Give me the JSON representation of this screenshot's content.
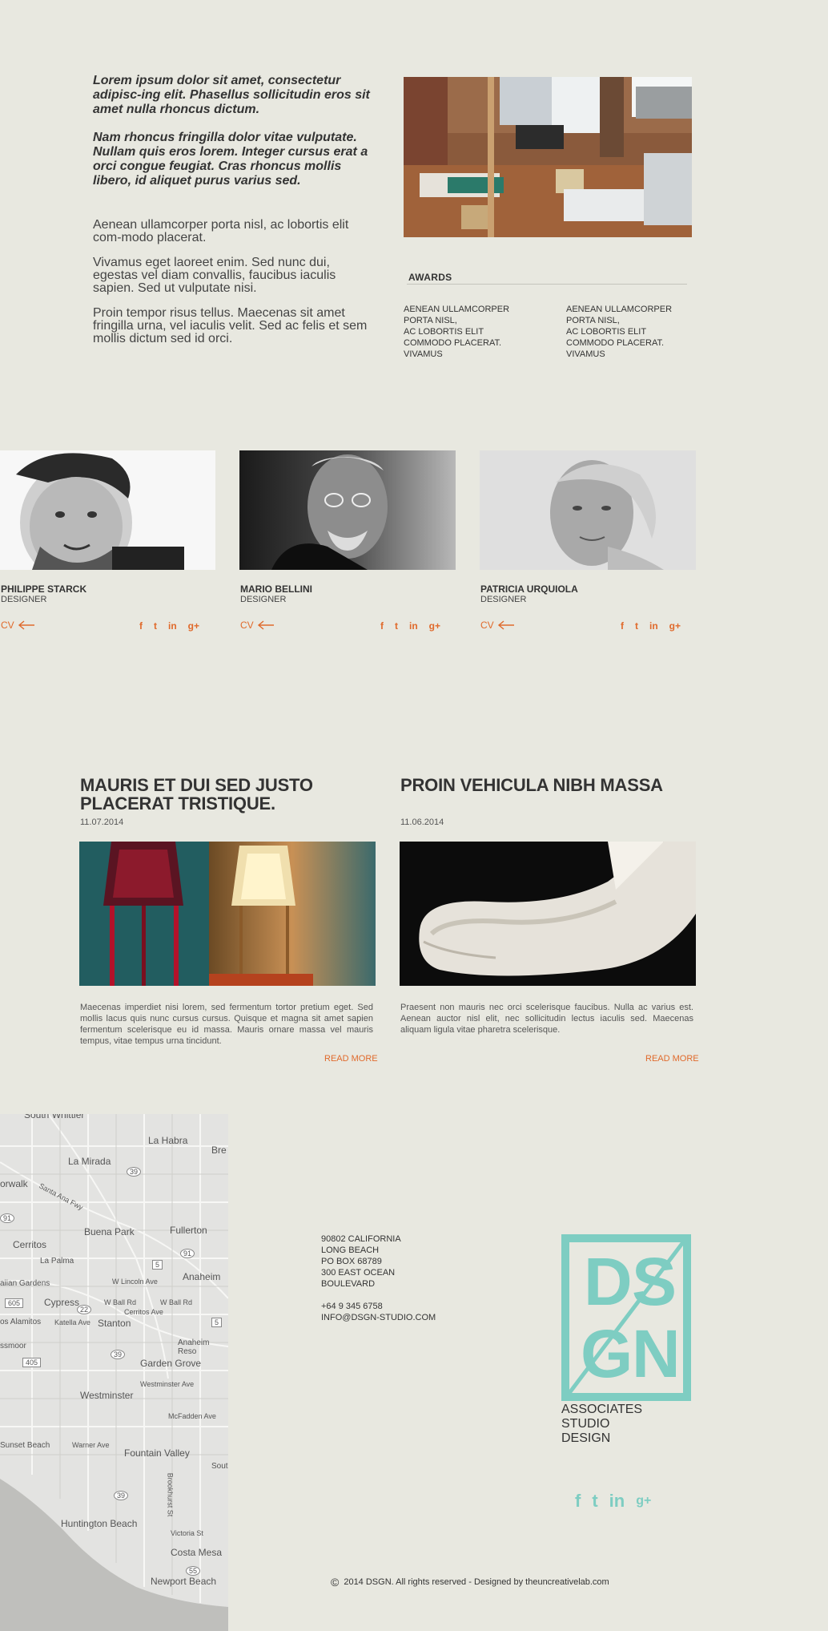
{
  "intro": {
    "italic_paragraphs": [
      "Lorem ipsum dolor sit amet, consectetur adipisc-ing elit. Phasellus sollicitudin eros sit amet nulla rhoncus dictum.",
      "Nam rhoncus fringilla dolor vitae vulputate. Nullam quis eros lorem. Integer cursus erat a orci congue feugiat. Cras rhoncus mollis libero, id aliquet purus varius sed."
    ],
    "regular_paragraphs": [
      "Aenean ullamcorper porta nisl, ac lobortis elit com-modo placerat.",
      "Vivamus eget laoreet enim. Sed nunc dui, egestas vel diam convallis, faucibus iaculis sapien. Sed ut vulputate nisi.",
      "Proin tempor risus tellus. Maecenas sit amet fringilla urna, vel iaculis velit. Sed ac felis et sem mollis dictum sed id orci."
    ]
  },
  "awards": {
    "title": "AWARDS",
    "columns": [
      [
        "AENEAN ULLAMCORPER PORTA NISL,",
        "AC LOBORTIS ELIT",
        "COMMODO PLACERAT.",
        "VIVAMUS"
      ],
      [
        "AENEAN ULLAMCORPER PORTA NISL,",
        "AC LOBORTIS ELIT",
        "COMMODO PLACERAT.",
        "VIVAMUS"
      ]
    ]
  },
  "team": {
    "cv_label": "CV",
    "members": [
      {
        "name": "PHILIPPE STARCK",
        "role": "DESIGNER"
      },
      {
        "name": "MARIO BELLINI",
        "role": "DESIGNER"
      },
      {
        "name": "PATRICIA URQUIOLA",
        "role": "DESIGNER"
      }
    ],
    "social_glyphs": [
      "f",
      "t",
      "in",
      "g+"
    ]
  },
  "posts": [
    {
      "title": "MAURIS ET DUI SED JUSTO PLACERAT TRISTIQUE.",
      "date": "11.07.2014",
      "excerpt": "Maecenas imperdiet nisi lorem, sed fermentum tortor pretium eget. Sed mollis lacus quis nunc cursus cursus. Quisque et magna sit amet sapien fermentum scelerisque eu id massa. Mauris ornare massa vel mauris tempus, vitae tempus urna tincidunt.",
      "read_more": "READ MORE"
    },
    {
      "title": "PROIN VEHICULA NIBH MASSA",
      "date": "11.06.2014",
      "excerpt": "Praesent non mauris nec orci scelerisque faucibus. Nulla ac varius est. Aenean auctor nisl elit, nec sollicitudin lectus iaculis sed. Maecenas aliquam ligula vitae pharetra scelerisque.",
      "read_more": "READ MORE"
    }
  ],
  "map": {
    "labels": [
      "South Whittier",
      "La Habra",
      "La Mirada",
      "orwalk",
      "Santa Ana Fwy",
      "Fullerton",
      "Buena Park",
      "Cerritos",
      "La Palma",
      "Anaheim",
      "W Lincoln Ave",
      "aiian Gardens",
      "Cypress",
      "W Ball Rd",
      "Cerritos Ave",
      "os Alamitos",
      "Katella Ave",
      "Stanton",
      "ssmoor",
      "Anaheim Reso",
      "Garden Grove",
      "Westminster Ave",
      "Westminster",
      "McFadden Ave",
      "Sunset Beach",
      "Warner Ave",
      "Fountain Valley",
      "Brookhurst St",
      "Huntington Beach",
      "Victoria St",
      "Costa Mesa",
      "Newport Beach",
      "Bre",
      "Sout"
    ],
    "shields": [
      "39",
      "91",
      "5",
      "91",
      "605",
      "22",
      "5",
      "405",
      "39",
      "39",
      "55"
    ]
  },
  "contact": {
    "address_lines": [
      "90802 CALIFORNIA",
      "LONG BEACH",
      "PO BOX 68789",
      "300 EAST OCEAN",
      "BOULEVARD"
    ],
    "phone": "+64 9 345 6758",
    "email": "INFO@DSGN-STUDIO.COM"
  },
  "brand": {
    "logo_letters": [
      "D",
      "S",
      "G",
      "N"
    ],
    "tagline": [
      "ASSOCIATES",
      "STUDIO",
      "DESIGN"
    ],
    "accent_color": "#7ecdc2",
    "orange_color": "#e06a2c"
  },
  "footer": {
    "copyright_symbol": "©",
    "copyright_text": "2014  DSGN. All rights reserved - Designed by theuncreativelab.com"
  }
}
